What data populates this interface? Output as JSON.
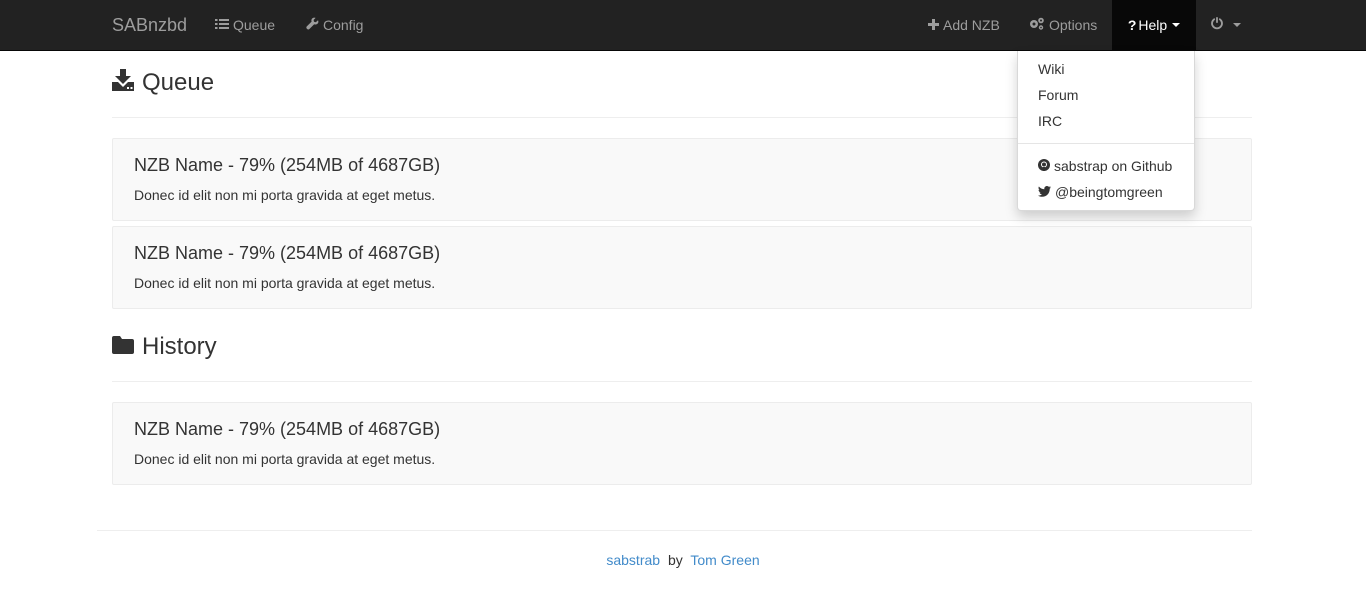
{
  "navbar": {
    "brand": "SABnzbd",
    "queue_label": "Queue",
    "config_label": "Config",
    "add_nzb_label": "Add NZB",
    "options_label": "Options",
    "help_label": "Help"
  },
  "help_menu": {
    "items": [
      "Wiki",
      "Forum",
      "IRC"
    ],
    "github_label": "sabstrap on Github",
    "twitter_label": "@beingtomgreen"
  },
  "queue": {
    "title": "Queue",
    "items": [
      {
        "name": "NZB Name - 79% (254MB of 4687GB)",
        "description": "Donec id elit non mi porta gravida at eget metus."
      },
      {
        "name": "NZB Name - 79% (254MB of 4687GB)",
        "description": "Donec id elit non mi porta gravida at eget metus."
      }
    ]
  },
  "history": {
    "title": "History",
    "items": [
      {
        "name": "NZB Name - 79% (254MB of 4687GB)",
        "description": "Donec id elit non mi porta gravida at eget metus."
      }
    ]
  },
  "footer": {
    "project_link": "sabstrab",
    "by_text": "by",
    "author_link": "Tom Green"
  },
  "colors": {
    "navbar_bg": "#222222",
    "nav_text": "#9d9d9d",
    "active_bg": "#080808",
    "link": "#428bca",
    "well_bg": "#f9f9f9"
  },
  "icons": {
    "queue": "list-icon",
    "config": "wrench-icon",
    "add_nzb": "plus-icon",
    "options": "cogs-icon",
    "help": "question-icon",
    "power": "power-icon",
    "queue_heading": "download-icon",
    "history_heading": "folder-icon",
    "github": "github-icon",
    "twitter": "twitter-icon"
  }
}
